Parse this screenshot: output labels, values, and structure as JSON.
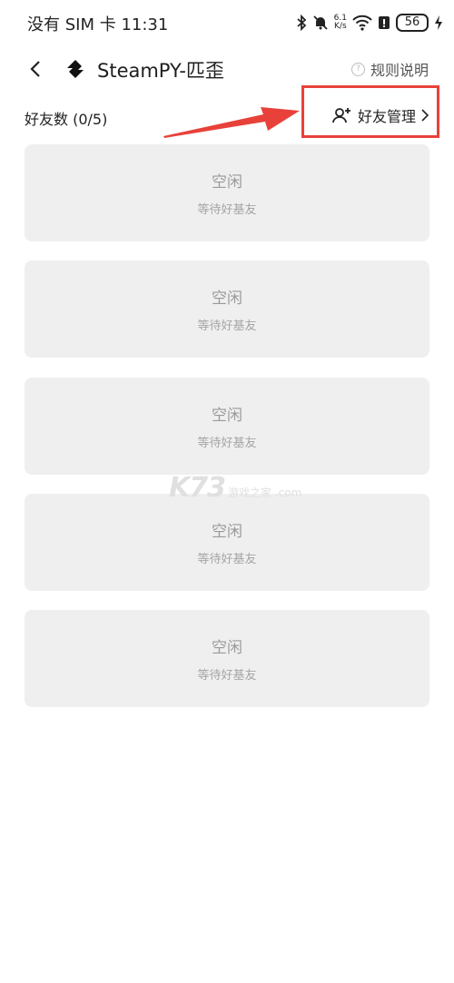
{
  "status_bar": {
    "carrier": "没有 SIM 卡",
    "time": "11:31",
    "speed_value": "6.1",
    "speed_unit": "K/s",
    "battery": "56"
  },
  "header": {
    "title": "SteamPY-匹歪",
    "rules_label": "规则说明"
  },
  "friends": {
    "count_label": "好友数 (0/5)",
    "manage_label": "好友管理",
    "slots": [
      {
        "title": "空闲",
        "subtitle": "等待好基友"
      },
      {
        "title": "空闲",
        "subtitle": "等待好基友"
      },
      {
        "title": "空闲",
        "subtitle": "等待好基友"
      },
      {
        "title": "空闲",
        "subtitle": "等待好基友"
      },
      {
        "title": "空闲",
        "subtitle": "等待好基友"
      }
    ]
  },
  "watermark": {
    "text": "K73",
    "sub": "游戏之家 .com"
  },
  "colors": {
    "highlight": "#e8413a",
    "slot_bg": "#efefef"
  }
}
